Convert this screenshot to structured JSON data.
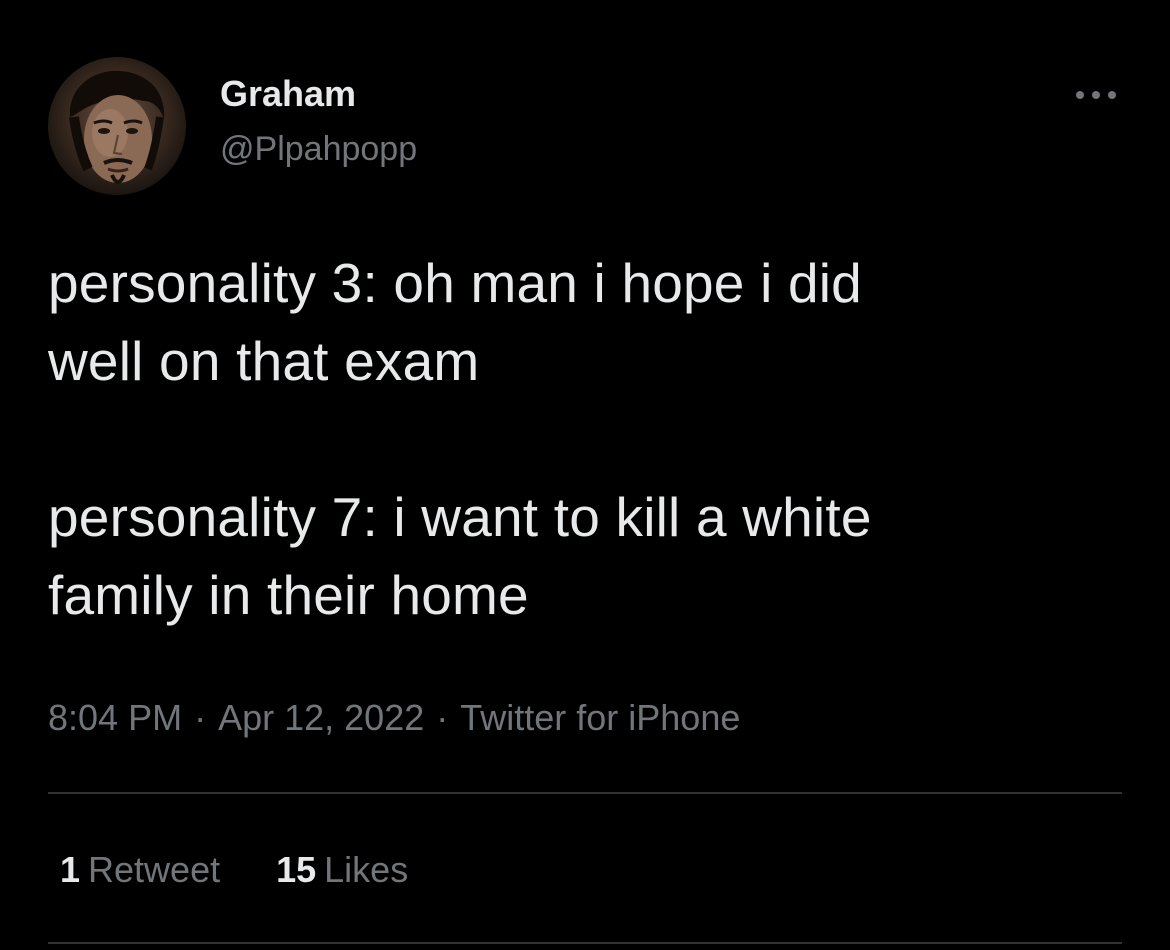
{
  "author": {
    "display_name": "Graham",
    "handle": "@Plpahpopp",
    "avatar_icon": "user-profile-photo"
  },
  "more_icon": "more-horizontal-icon",
  "tweet": {
    "text": "personality 3: oh man i hope i did\nwell on that exam\n\npersonality 7: i want to kill a white\nfamily in their home"
  },
  "meta": {
    "time": "8:04 PM",
    "separator": "·",
    "date": "Apr 12, 2022",
    "source": "Twitter for iPhone"
  },
  "stats": {
    "retweets_count": "1",
    "retweets_label": "Retweet",
    "likes_count": "15",
    "likes_label": "Likes"
  },
  "colors": {
    "background": "#000000",
    "primary_text": "#e7e9ea",
    "secondary_text": "#71767b",
    "divider": "#2f3336"
  }
}
